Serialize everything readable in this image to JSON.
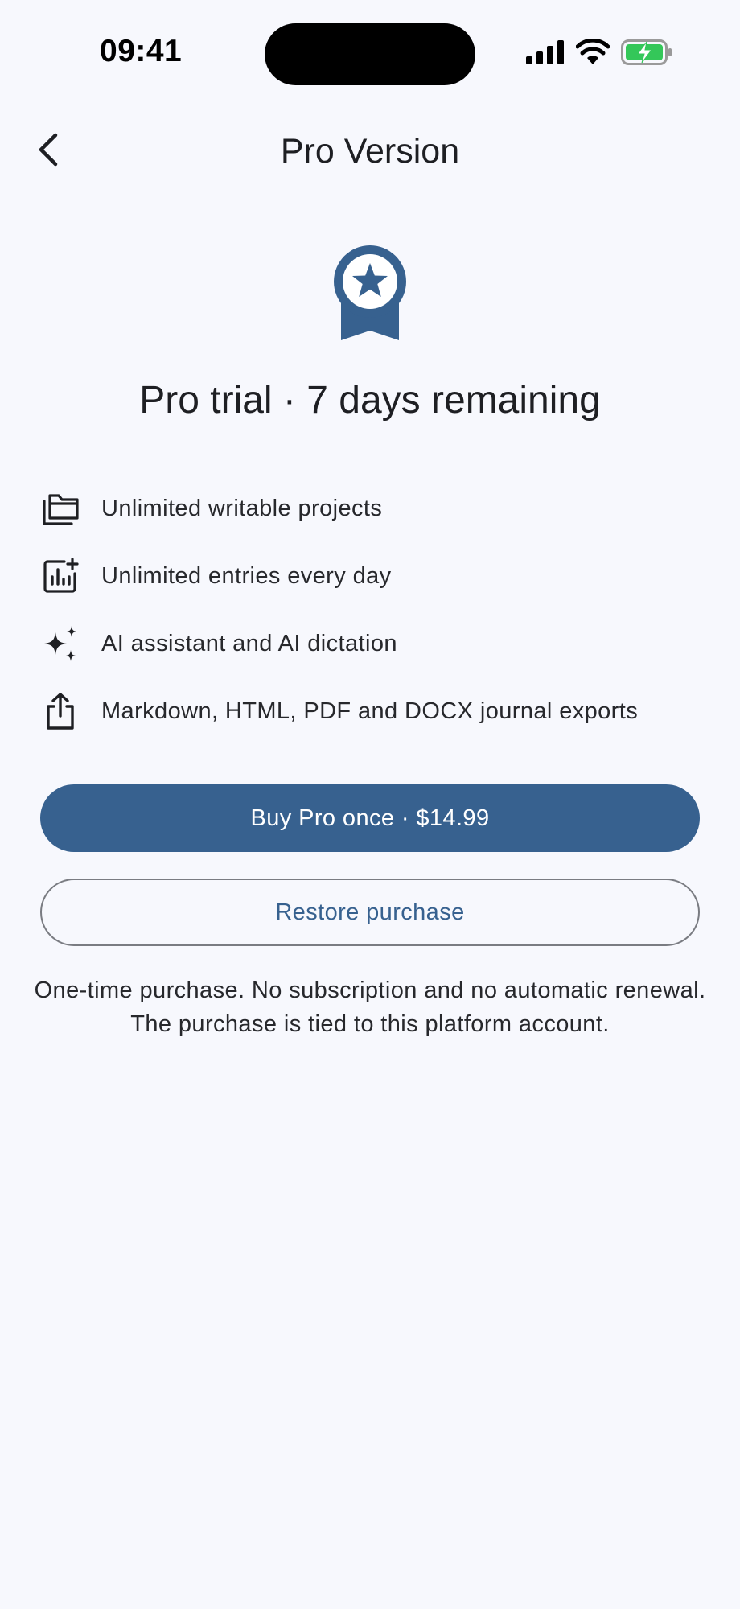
{
  "status_bar": {
    "time": "09:41",
    "icons": [
      "cellular-signal-icon",
      "wifi-icon",
      "battery-charging-icon"
    ]
  },
  "header": {
    "back_icon": "chevron-left-icon",
    "title": "Pro Version"
  },
  "hero": {
    "icon": "award-ribbon-icon",
    "heading": "Pro trial · 7 days remaining"
  },
  "features": [
    {
      "icon": "folders-icon",
      "label": "Unlimited writable projects"
    },
    {
      "icon": "chart-add-icon",
      "label": "Unlimited entries every day"
    },
    {
      "icon": "sparkles-icon",
      "label": "AI assistant and AI dictation"
    },
    {
      "icon": "share-export-icon",
      "label": "Markdown, HTML, PDF and DOCX journal exports"
    }
  ],
  "actions": {
    "buy_label": "Buy Pro once · $14.99",
    "restore_label": "Restore purchase"
  },
  "disclaimer": "One-time purchase. No subscription and no automatic renewal. The purchase is tied to this platform account.",
  "colors": {
    "background": "#f7f8fd",
    "primary": "#37618f",
    "text": "#1e1f23",
    "battery": "#34c759"
  }
}
